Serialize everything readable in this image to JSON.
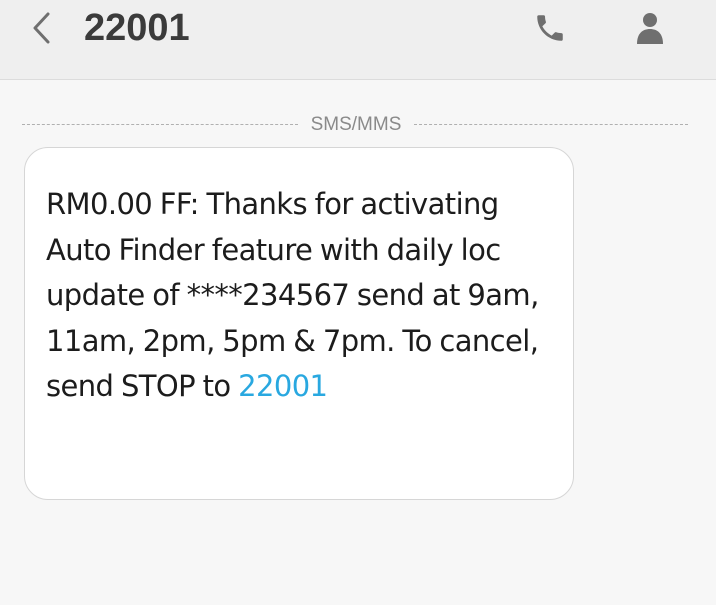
{
  "header": {
    "title": "22001",
    "back_icon": "chevron-left-icon",
    "call_icon": "phone-icon",
    "contact_icon": "person-icon",
    "icon_color": "#6f6f6f"
  },
  "separator": {
    "label": "SMS/MMS"
  },
  "message": {
    "body_text": "RM0.00 FF: Thanks for activating Auto Finder feature with daily loc update of ****234567 send at 9am, 11am, 2pm, 5pm & 7pm. To cancel, send STOP to ",
    "link_text": "22001",
    "link_color": "#29a8e0"
  }
}
